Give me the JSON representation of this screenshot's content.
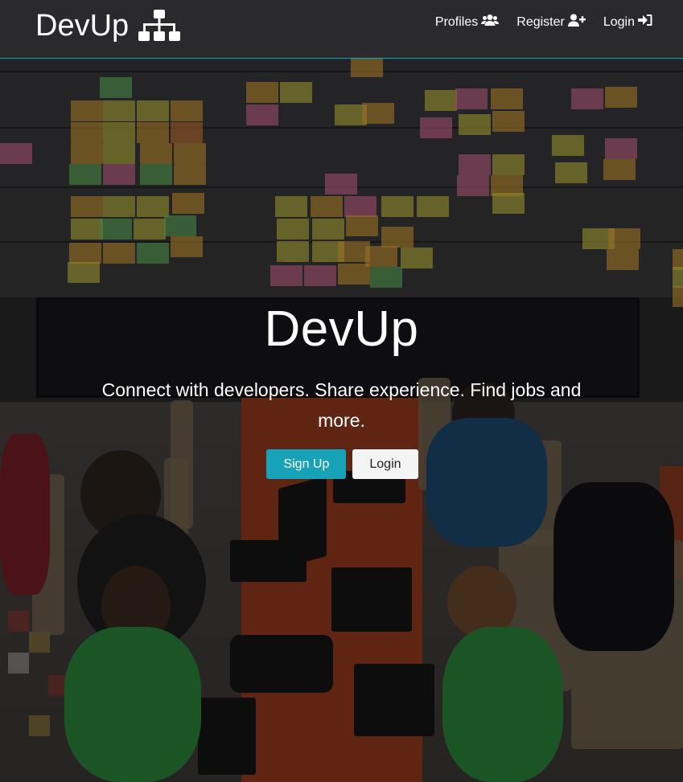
{
  "navbar": {
    "brand": "DevUp",
    "brand_icon": "sitemap-icon",
    "links": [
      {
        "label": "Profiles",
        "icon": "users-icon"
      },
      {
        "label": "Register",
        "icon": "user-plus-icon"
      },
      {
        "label": "Login",
        "icon": "sign-in-icon"
      }
    ]
  },
  "landing": {
    "title": "DevUp",
    "lead": "Connect with developers. Share experience. Find jobs and more.",
    "signup_label": "Sign Up",
    "login_label": "Login"
  },
  "colors": {
    "accent": "#17a2b8",
    "light_button": "#f4f4f4",
    "navbar": "#2b2b2e"
  }
}
